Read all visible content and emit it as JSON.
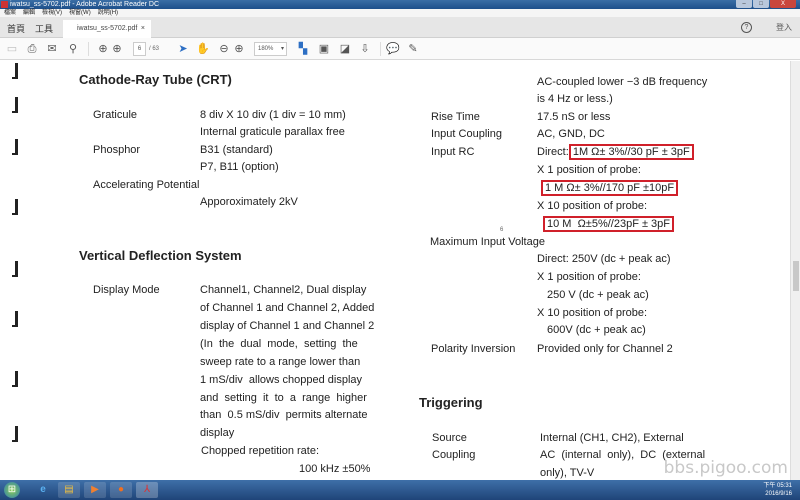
{
  "window": {
    "title": "iwatsu_ss-5702.pdf - Adobe Acrobat Reader DC",
    "minimize": "–",
    "maximize": "□",
    "close": "X"
  },
  "menu": [
    "檔案",
    "編輯",
    "檢視(V)",
    "視窗(W)",
    "說明(H)"
  ],
  "tabs": {
    "home": "首頁",
    "tools": "工具",
    "document": "iwatsu_ss-5702.pdf",
    "close": "×",
    "help": "?",
    "login": "登入"
  },
  "toolbar": {
    "page": "6",
    "total": "/ 63",
    "zoom": "180%",
    "zoom_caret": "▾"
  },
  "doc": {
    "crt_title": "Cathode-Ray Tube (CRT)",
    "graticule_label": "Graticule",
    "graticule_1": "8 div X 10 div (1 div = 10 mm)",
    "graticule_2": "Internal graticule parallax free",
    "phosphor_label": "Phosphor",
    "phosphor_1": "B31 (standard)",
    "phosphor_2": "P7, B11 (option)",
    "accel_label": "Accelerating Potential",
    "accel_value": "Apporoximately 2kV",
    "vds_title": "Vertical Deflection System",
    "display_mode_label": "Display Mode",
    "display_mode_lines": [
      "Channel1, Channel2,  Dual display",
      "of Channel 1 and Channel 2, Added",
      "display of Channel 1 and Channel 2",
      "(In  the  dual  mode,  setting  the",
      "sweep rate to a range lower than",
      "1 mS/div  allows chopped display",
      "and  setting  it  to  a  range  higher",
      "than  0.5 mS/div  permits alternate",
      "display"
    ],
    "chopped_label": "Chopped repetition rate:",
    "chopped_value": "100 kHz ±50%",
    "ac_1": "AC-coupled lower −3 dB frequency",
    "ac_2": "is 4 Hz or less.)",
    "rise_label": "Rise Time",
    "rise_value": "17.5 nS or less",
    "coupling_label": "Input Coupling",
    "coupling_value": "AC, GND, DC",
    "rc_label": "Input RC",
    "rc_direct_prefix": "Direct:",
    "rc_direct": "1M Ω± 3%//30 pF ± 3pF",
    "rc_x1_label": "X 1 position of probe:",
    "rc_x1": "1 M Ω± 3%//170 pF ±10pF",
    "rc_x10_label": "X 10 position of probe:",
    "rc_x10": "10 M  Ω±5%//23pF ± 3pF",
    "page_mark": "6",
    "max_label": "Maximum Input Voltage",
    "max_direct": "Direct: 250V (dc + peak ac)",
    "max_x1_label": "X 1 position of probe:",
    "max_x1": "250 V (dc + peak ac)",
    "max_x10_label": "X 10 position of probe:",
    "max_x10": "600V (dc + peak ac)",
    "polarity_label": "Polarity Inversion",
    "polarity_value": "Provided only for Channel 2",
    "trig_title": "Triggering",
    "source_label": "Source",
    "source_value": "Internal (CH1, CH2), External",
    "trig_coupling_label": "Coupling",
    "trig_coupling_1": "AC  (internal  only),  DC  (external",
    "trig_coupling_2": "only), TV-V",
    "highlight_color": "#d0202a"
  },
  "watermark": "bbs.pigoo.com",
  "taskbar": {
    "time": "下午 05:31",
    "date": "2016/9/16",
    "apps": [
      "start",
      "internet-explorer",
      "file-explorer",
      "media-player",
      "firefox",
      "acrobat-reader"
    ]
  }
}
